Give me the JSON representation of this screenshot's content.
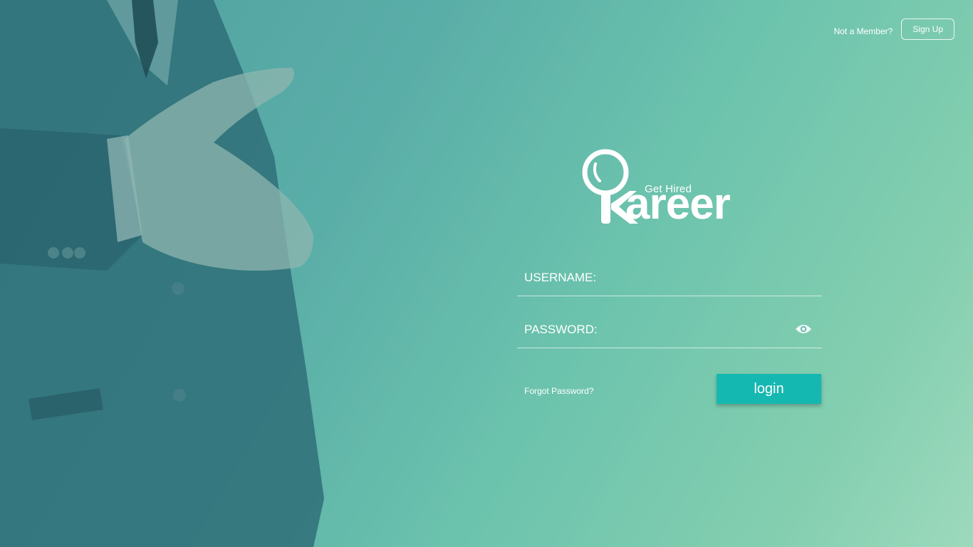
{
  "header": {
    "not_member_text": "Not a Member?",
    "signup_label": "Sign Up"
  },
  "logo": {
    "tagline": "Get Hired",
    "wordmark": "areer",
    "icon": "magnifier-k-icon"
  },
  "form": {
    "username_label": "USERNAME:",
    "username_value": "",
    "password_label": "PASSWORD:",
    "password_value": "",
    "show_password_icon": "eye-icon",
    "forgot_label": "Forgot Password?",
    "login_label": "login"
  },
  "colors": {
    "login_button": "#14b8b0",
    "background_start": "#4f9f9f",
    "background_end": "#9dd9bd"
  }
}
